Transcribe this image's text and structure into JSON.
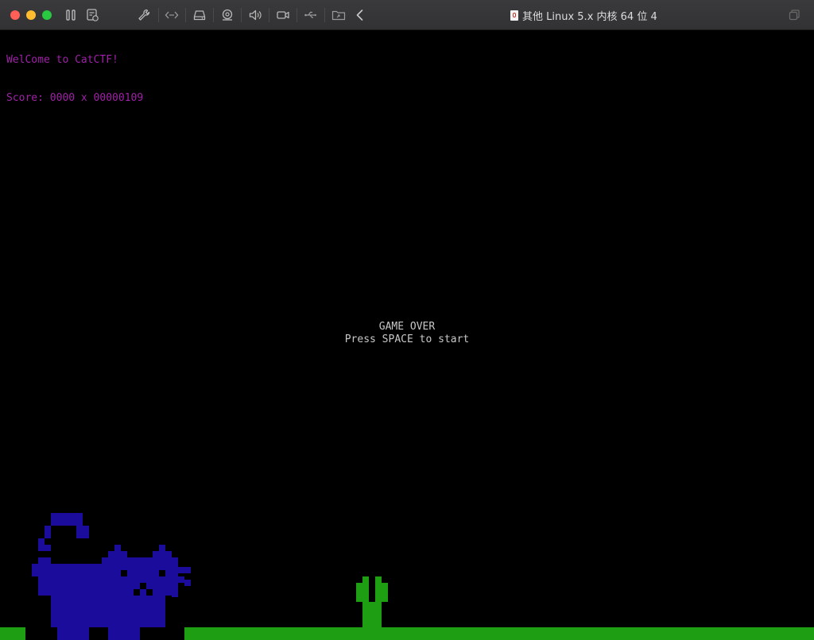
{
  "window": {
    "title": "其他 Linux 5.x 内核 64 位 4"
  },
  "toolbar": {
    "icons": [
      "pause-icon",
      "snapshot-icon",
      "settings-wrench-icon",
      "network-icon",
      "hard-disk-icon",
      "camera-capture-icon",
      "sound-icon",
      "video-camera-icon",
      "usb-icon",
      "shared-folder-icon",
      "back-chevron-icon",
      "window-mode-icon"
    ]
  },
  "game": {
    "welcome": "WelCome to CatCTF!",
    "score_line": "Score: 0000 x 00000109",
    "game_over": "GAME OVER",
    "prompt": "Press SPACE to start"
  },
  "colors": {
    "text_purple": "#a020a8",
    "text_gray": "#c8c8c8",
    "cat_blue": "#1c0c9c",
    "cactus_green": "#1e9e12",
    "ground_green": "#1e9e12"
  }
}
